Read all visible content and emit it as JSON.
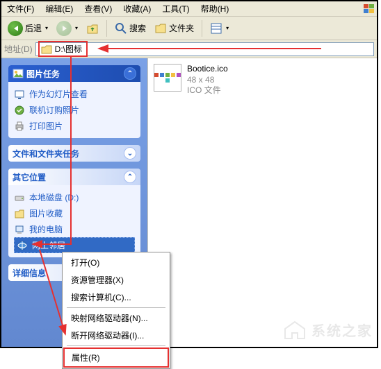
{
  "menubar": {
    "items": [
      {
        "label": "文件(F)"
      },
      {
        "label": "编辑(E)"
      },
      {
        "label": "查看(V)"
      },
      {
        "label": "收藏(A)"
      },
      {
        "label": "工具(T)"
      },
      {
        "label": "帮助(H)"
      }
    ]
  },
  "toolbar": {
    "back_label": "后退",
    "search_label": "搜索",
    "folders_label": "文件夹"
  },
  "addressbar": {
    "label": "地址(D)",
    "path": "D:\\图标"
  },
  "sidebar": {
    "panels": [
      {
        "title": "图片任务",
        "primary": true,
        "tasks": [
          {
            "icon": "slideshow-icon",
            "label": "作为幻灯片查看"
          },
          {
            "icon": "order-prints-icon",
            "label": "联机订购照片"
          },
          {
            "icon": "print-icon",
            "label": "打印图片"
          }
        ]
      },
      {
        "title": "文件和文件夹任务",
        "primary": false,
        "tasks": []
      },
      {
        "title": "其它位置",
        "primary": false,
        "tasks": [
          {
            "icon": "drive-icon",
            "label": "本地磁盘 (D:)"
          },
          {
            "icon": "pictures-icon",
            "label": "图片收藏"
          },
          {
            "icon": "computer-icon",
            "label": "我的电脑"
          },
          {
            "icon": "network-icon",
            "label": "网上邻居",
            "selected": true
          }
        ]
      },
      {
        "title": "详细信息",
        "primary": false,
        "tasks": []
      }
    ]
  },
  "content": {
    "file": {
      "name": "Bootice.ico",
      "dims": "48 x 48",
      "type": "ICO 文件"
    }
  },
  "context_menu": {
    "items": [
      {
        "label": "打开(O)"
      },
      {
        "label": "资源管理器(X)"
      },
      {
        "label": "搜索计算机(C)..."
      },
      {
        "sep": true
      },
      {
        "label": "映射网络驱动器(N)..."
      },
      {
        "label": "断开网络驱动器(I)..."
      },
      {
        "sep": true
      },
      {
        "label": "属性(R)",
        "highlight": true
      }
    ]
  },
  "watermark": {
    "text": "系统之家"
  }
}
